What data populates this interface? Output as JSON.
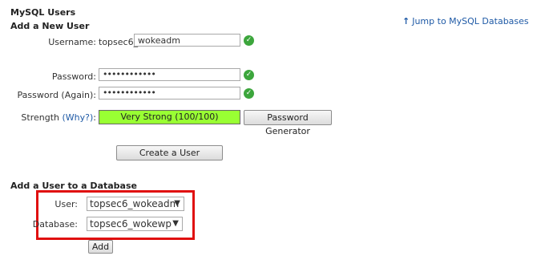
{
  "header": {
    "section_title": "MySQL Users",
    "subsection_title": "Add a New User",
    "jump_arrow": "↑",
    "jump_link": "Jump to MySQL Databases"
  },
  "new_user": {
    "username_label": "Username:",
    "username_prefix": "topsec6_",
    "username_value": "wokeadm",
    "password_label": "Password:",
    "password_value": "••••••••••••",
    "password_again_label": "Password (Again):",
    "password_again_value": "••••••••••••",
    "strength_label": "Strength",
    "why_link": "(Why?)",
    "strength_colon": ":",
    "strength_value": "Very Strong (100/100)",
    "strength_color": "#99ff33",
    "password_generator_button": "Password Generator",
    "create_user_button": "Create a User",
    "valid_icon": "check-circle-icon",
    "valid_color": "#3ca63c"
  },
  "add_to_db": {
    "title": "Add a User to a Database",
    "user_label": "User:",
    "user_selected": "topsec6_wokeadm",
    "database_label": "Database:",
    "database_selected": "topsec6_wokewp",
    "add_button": "Add",
    "highlight_color": "#e01010"
  }
}
